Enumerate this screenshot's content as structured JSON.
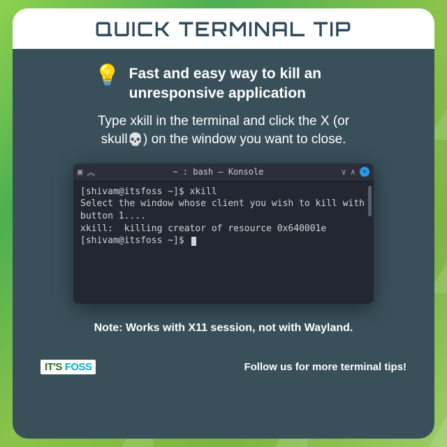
{
  "header": {
    "title": "QUICK TERMINAL TIP"
  },
  "tip": {
    "bulb_icon": "💡",
    "headline": "Fast and easy way to kill an unresponsive application",
    "instruction_pre": "Type xkill in the terminal and click the X (or skull",
    "skull_icon": "💀",
    "instruction_post": ") on the window you want to close."
  },
  "terminal": {
    "title": "~ : bash — Konsole",
    "lines": [
      "[shivam@itsfoss ~]$ xkill",
      "Select the window whose client you wish to kill with button 1....",
      "xkill:  killing creator of resource 0x640001e",
      "[shivam@itsfoss ~]$ "
    ]
  },
  "note": "Note: Works with X11 session, not with Wayland.",
  "footer": {
    "logo_its": "IT'S",
    "logo_foss": " FOSS",
    "follow": "Follow us for more terminal tips!"
  }
}
